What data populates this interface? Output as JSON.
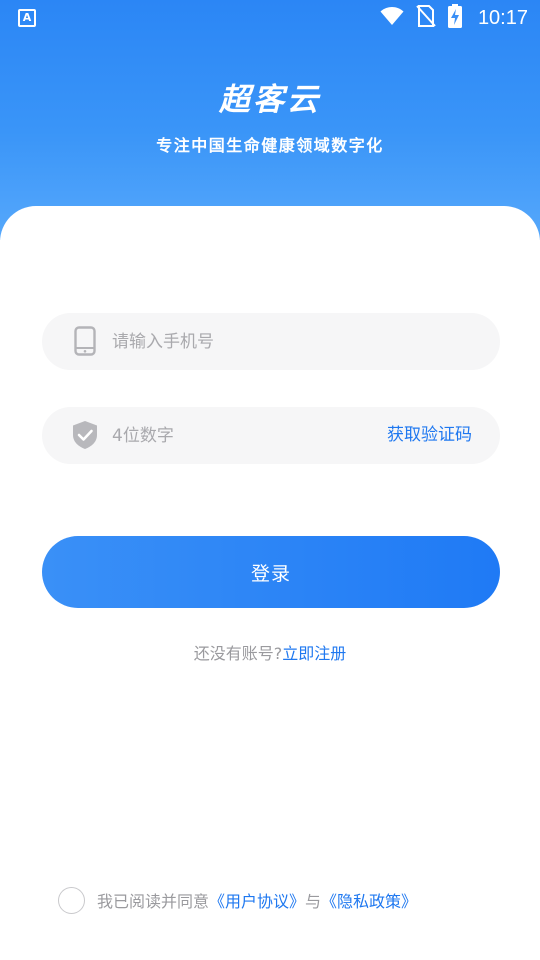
{
  "status_bar": {
    "app_icon": "A",
    "wifi_icon": "wifi-icon",
    "signal_icon": "no-signal-icon",
    "battery_icon": "battery-charging-icon",
    "time": "10:17"
  },
  "header": {
    "title": "超客云",
    "subtitle": "专注中国生命健康领域数字化"
  },
  "form": {
    "phone": {
      "icon": "phone-icon",
      "value": "",
      "placeholder": "请输入手机号"
    },
    "code": {
      "icon": "shield-check-icon",
      "value": "",
      "placeholder": "4位数字",
      "get_code_label": "获取验证码"
    },
    "login_label": "登录"
  },
  "register": {
    "prompt": "还没有账号?",
    "link_label": "立即注册"
  },
  "agreement": {
    "checked": false,
    "prefix": "我已阅读并同意",
    "user_agreement": "《用户协议》",
    "joiner": "与",
    "privacy_policy": "《隐私政策》"
  },
  "colors": {
    "brand_blue": "#1f78f0",
    "header_gradient_top": "#2b86f5",
    "field_background": "#f6f6f7",
    "muted_text": "#9a9a9e"
  }
}
